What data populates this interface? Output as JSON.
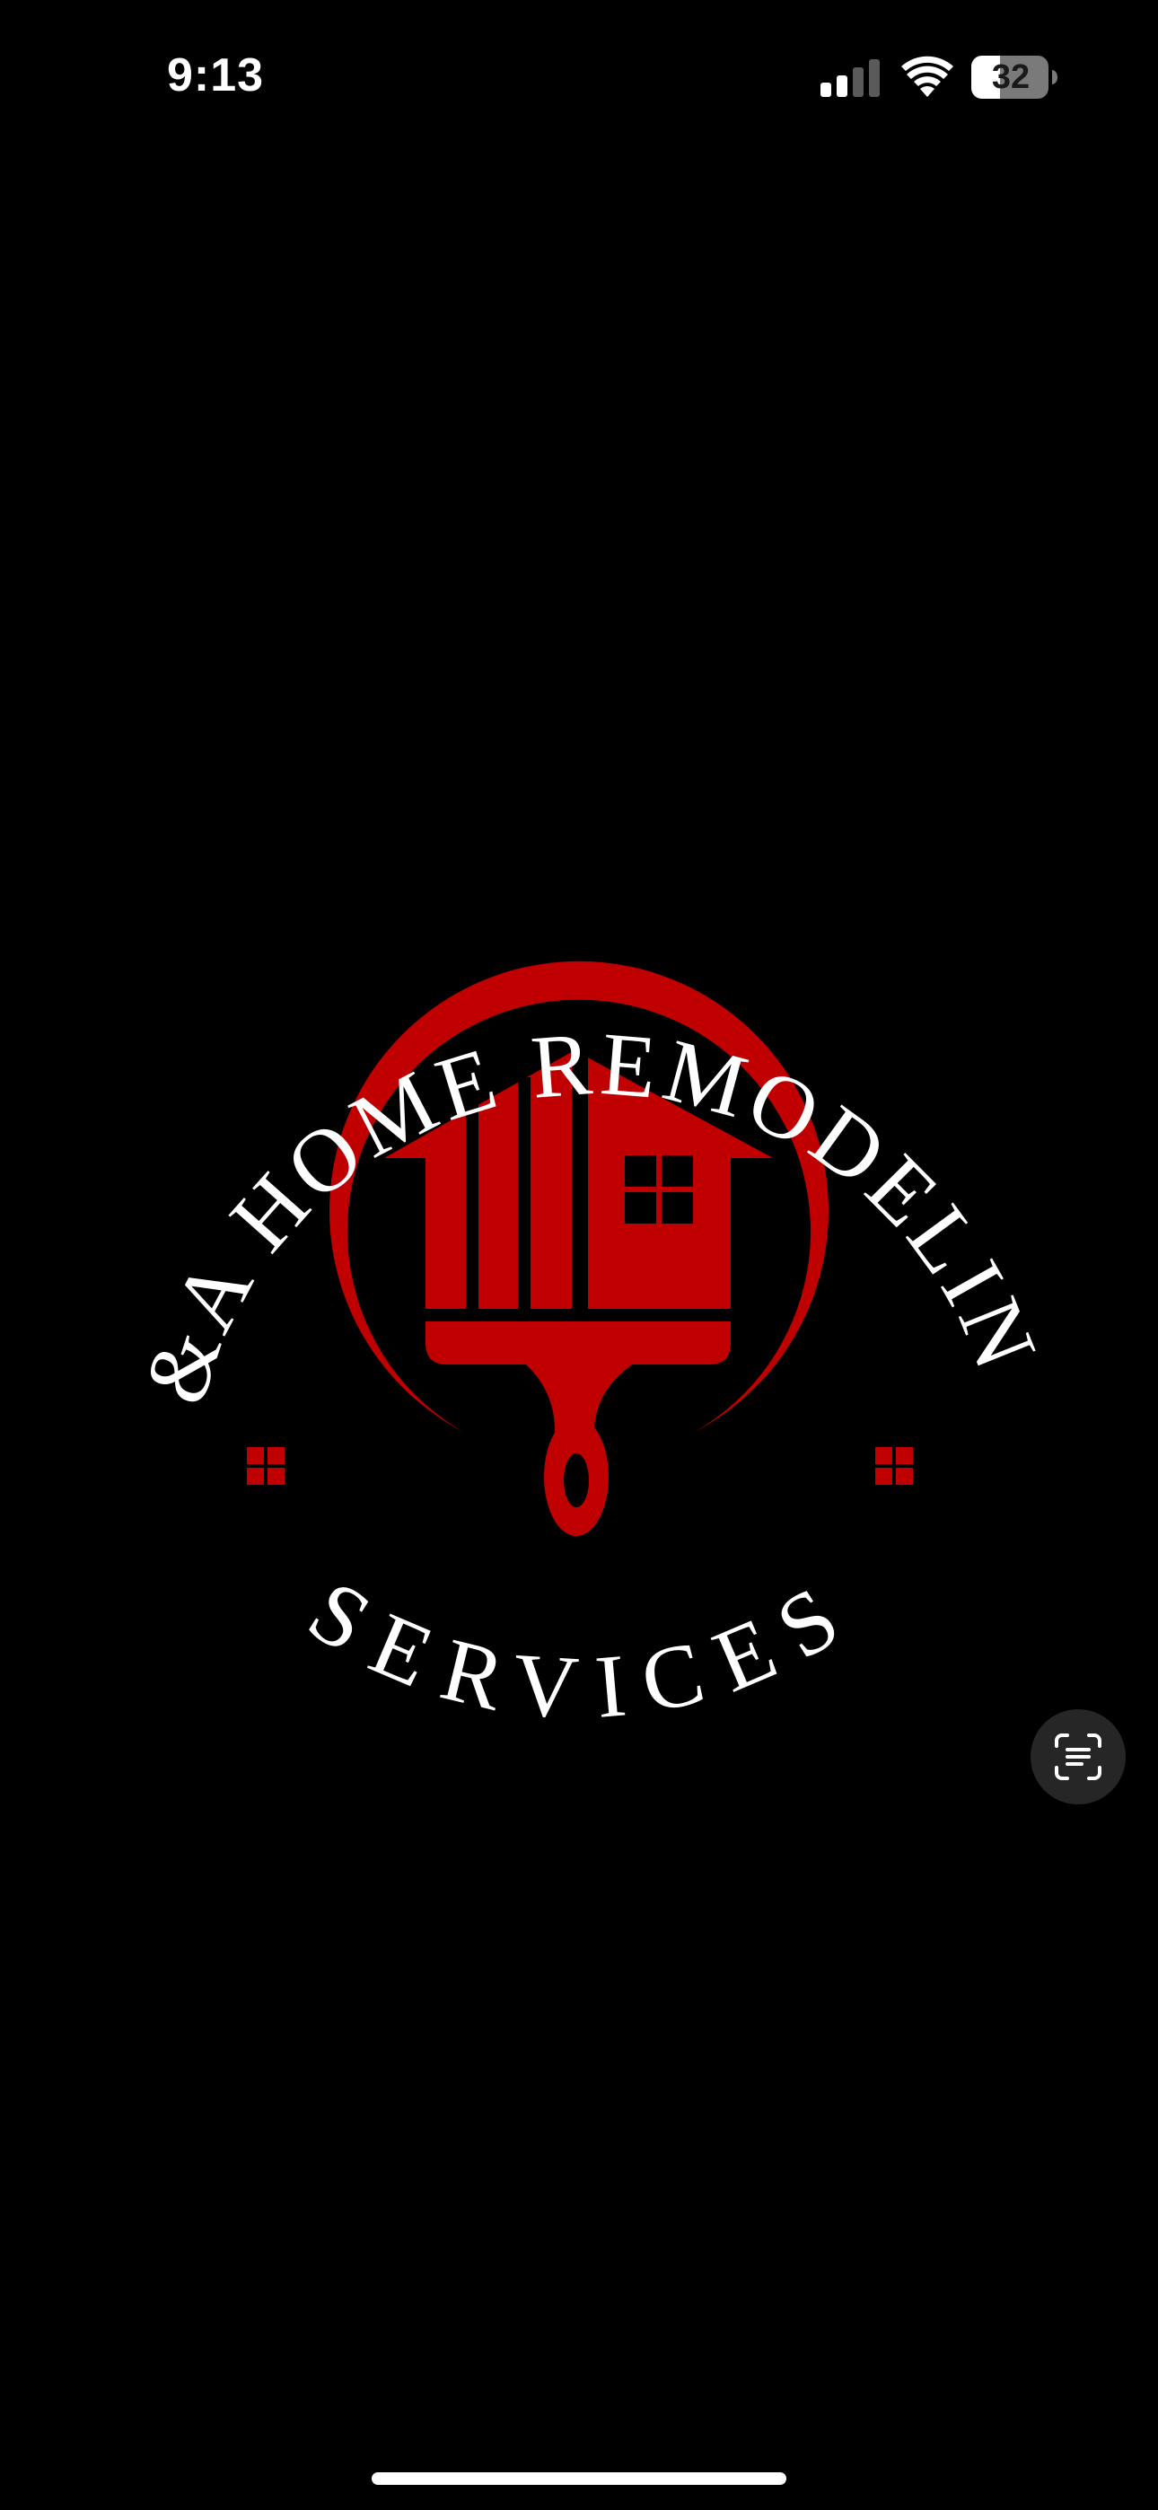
{
  "status_bar": {
    "time": "9:13",
    "battery_level": "32",
    "signal_icon": "cellular-signal-icon",
    "wifi_icon": "wifi-icon",
    "battery_icon": "battery-icon"
  },
  "logo": {
    "arc_text_top": "J&A HOME REMODELING",
    "arc_text_bottom": "SERVICES",
    "brand_red": "#c00000",
    "text_color": "#ffffff",
    "background": "#000000",
    "icon": "house-paintbrush-logo"
  },
  "live_text_button": {
    "icon": "live-text-scan-icon"
  },
  "home_indicator": {
    "icon": "home-indicator-bar"
  }
}
